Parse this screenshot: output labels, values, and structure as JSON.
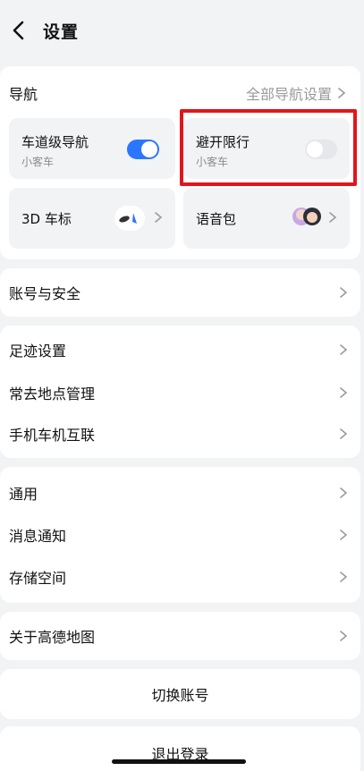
{
  "header": {
    "title": "设置"
  },
  "navigation": {
    "title": "导航",
    "all_settings": "全部导航设置",
    "tiles": {
      "lane_nav": {
        "title": "车道级导航",
        "sub": "小客车",
        "enabled": true
      },
      "avoid_restrictions": {
        "title": "避开限行",
        "sub": "小客车",
        "enabled": false
      },
      "car_icon": {
        "title": "3D 车标"
      },
      "voice_pack": {
        "title": "语音包"
      }
    }
  },
  "sections": {
    "account_security": "账号与安全",
    "footprint_settings": "足迹设置",
    "frequent_places": "常去地点管理",
    "phone_car_link": "手机车机互联",
    "general": "通用",
    "notifications": "消息通知",
    "storage": "存储空间",
    "about": "关于高德地图"
  },
  "actions": {
    "switch_account": "切换账号",
    "logout": "退出登录"
  },
  "colors": {
    "accent": "#2b76ff",
    "highlight": "#e1161b",
    "background": "#f2f3f5"
  }
}
